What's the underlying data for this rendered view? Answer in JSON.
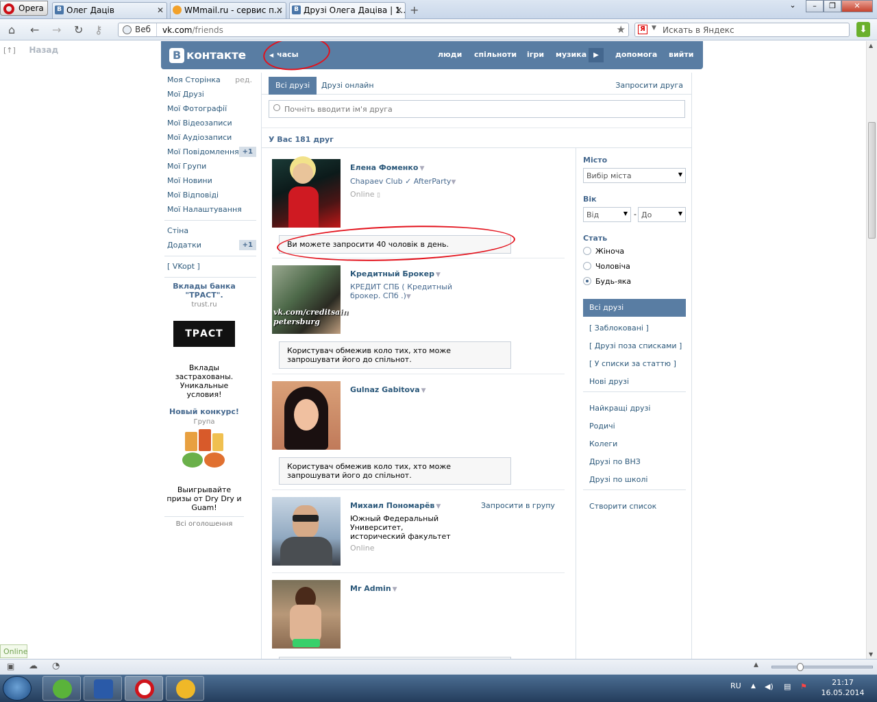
{
  "browser": {
    "opera_label": "Opera",
    "tabs": [
      {
        "label": "Олег Дацiв"
      },
      {
        "label": "WMmail.ru - сервис п..."
      },
      {
        "label": "Друзі Олега Даціва | 1..."
      }
    ],
    "web_label": "Веб",
    "url_host": "vk.com",
    "url_path": "/friends",
    "search_placeholder": "Искать в Яндекс"
  },
  "page": {
    "back_label": "Назад",
    "back_icon_label": "[↑]"
  },
  "vk_header": {
    "logo_text": "контакте",
    "clock_label": "часы",
    "menu": [
      "люди",
      "спільноти",
      "ігри",
      "музика",
      "допомога",
      "вийти"
    ]
  },
  "left_menu": {
    "items": [
      {
        "label": "Моя Сторінка",
        "extra": "ред."
      },
      {
        "label": "Мої Друзі"
      },
      {
        "label": "Мої Фотографії"
      },
      {
        "label": "Мої Відеозаписи"
      },
      {
        "label": "Мої Аудіозаписи"
      },
      {
        "label": "Мої Повідомлення",
        "count": "+1"
      },
      {
        "label": "Мої Групи"
      },
      {
        "label": "Мої Новини"
      },
      {
        "label": "Мої Відповіді"
      },
      {
        "label": "Мої Налаштування"
      }
    ],
    "items2": [
      {
        "label": "Стіна"
      },
      {
        "label": "Додатки",
        "count": "+1"
      }
    ],
    "vkopt": "[ VKopt ]"
  },
  "ads": {
    "ad1_title": "Вклады банка \"ТРАСТ\".",
    "ad1_domain": "trust.ru",
    "ad1_logo": "ТРАСТ",
    "ad1_text": "Вклады застрахованы. Уникальные условия!",
    "ad2_title": "Новый конкурс!",
    "ad2_sub": "Група",
    "ad2_text": "Выигрывайте призы от Dry Dry и Guam!",
    "all_ads": "Всі оголошення"
  },
  "main": {
    "tab_all": "Всі друзі",
    "tab_online": "Друзі онлайн",
    "invite_friend": "Запросити друга",
    "search_placeholder": "Почніть вводити ім'я друга",
    "count_text": "У Вас 181 друг"
  },
  "friends": [
    {
      "name": "Елена Фоменко",
      "info": "Chapaev Club ✓ AfterParty",
      "status": "Online",
      "note": "Ви можете запросити 40 чоловік в день."
    },
    {
      "name": "Кредитный Брокер",
      "info": "КРЕДИТ СПБ ( Кредитный брокер. СПб .)",
      "avatar_text1": "vk.com/creditsain",
      "avatar_text2": "petersburg",
      "note": "Користувач обмежив коло тих, хто може запрошувати його до спільнот."
    },
    {
      "name": "Gulnaz Gabitova",
      "note": "Користувач обмежив коло тих, хто може запрошувати його до спільнот."
    },
    {
      "name": "Михаил Пономарёв",
      "info": "Южный Федеральный Университет, исторический факультет",
      "status": "Online",
      "invite": "Запросити в групу"
    },
    {
      "name": "Mr Admin"
    }
  ],
  "filter": {
    "city_label": "Місто",
    "city_select": "Вибір міста",
    "age_label": "Вік",
    "age_from": "Від",
    "age_to": "До",
    "age_dash": "-",
    "sex_label": "Стать",
    "sex_options": [
      "Жіноча",
      "Чоловіча",
      "Будь-яка"
    ],
    "sex_selected": "Будь-яка",
    "lists_active": "Всі друзі",
    "lists": [
      "[ Заблоковані ]",
      "[ Друзі поза списками ]",
      "[ У списки за статтю ]",
      "Нові друзі"
    ],
    "lists2": [
      "Найкращі друзі",
      "Родичі",
      "Колеги",
      "Друзі по ВНЗ",
      "Друзі по школі"
    ],
    "create_list": "Створити список"
  },
  "status": {
    "online_badge": "Online"
  },
  "taskbar": {
    "lang": "RU",
    "time": "21:17",
    "date": "16.05.2014"
  },
  "colors": {
    "vk_blue": "#597da3",
    "link": "#2b587a",
    "annotation_red": "#e3111b"
  }
}
